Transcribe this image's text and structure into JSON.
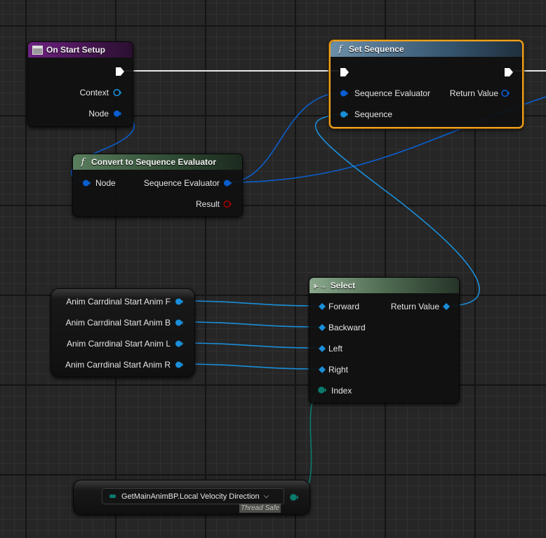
{
  "colors": {
    "accent_selected": "#f1a21d",
    "event_header": "#6a1e78",
    "function_header": "#35563c",
    "call_header": "#3a5a70",
    "exec_wire": "#e8e8e8",
    "struct_pin": "#0057c8",
    "object_pin": "#00a8f4",
    "byte_pin": "#006f65",
    "bool_result_pin": "#950000"
  },
  "nodes": {
    "on_start_setup": {
      "title": "On Start Setup",
      "icon": "event-icon",
      "pins": {
        "context": "Context",
        "node": "Node"
      }
    },
    "set_sequence": {
      "title": "Set Sequence",
      "icon": "function-icon",
      "pins": {
        "sequence_evaluator": "Sequence Evaluator",
        "sequence": "Sequence",
        "return_value": "Return Value"
      }
    },
    "convert": {
      "title": "Convert to Sequence Evaluator",
      "icon": "function-icon",
      "pins": {
        "node": "Node",
        "sequence_evaluator": "Sequence Evaluator",
        "result": "Result"
      }
    },
    "select": {
      "title": "Select",
      "icon": "select-icon",
      "pins": {
        "forward": "Forward",
        "backward": "Backward",
        "left": "Left",
        "right": "Right",
        "index": "Index",
        "return_value": "Return Value"
      }
    },
    "variables": {
      "items": [
        "Anim Carrdinal Start Anim F",
        "Anim Carrdinal Start Anim B",
        "Anim Carrdinal Start Anim L",
        "Anim Carrdinal Start Anim R"
      ]
    },
    "property_access": {
      "path": "GetMainAnimBP.Local Velocity Direction",
      "badge": "Thread Safe"
    }
  }
}
